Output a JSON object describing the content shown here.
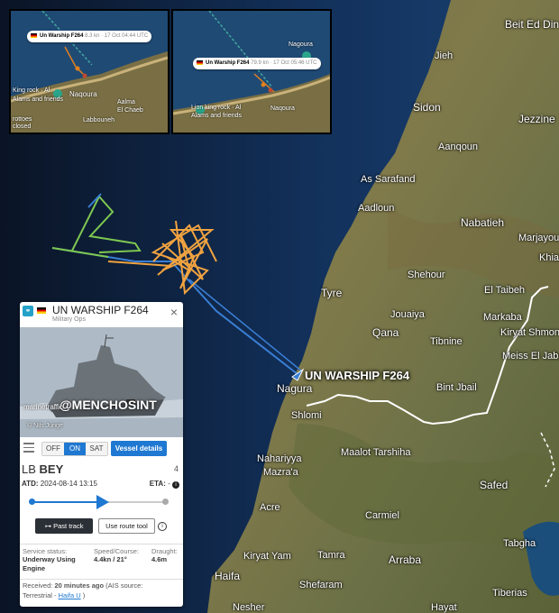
{
  "map": {
    "vessel_label": "UN WARSHIP F264",
    "places": [
      {
        "key": "beit",
        "name": "Beit Ed Dine"
      },
      {
        "key": "jieh",
        "name": "Jieh"
      },
      {
        "key": "sidon",
        "name": "Sidon"
      },
      {
        "key": "jezzine",
        "name": "Jezzine"
      },
      {
        "key": "aanqoun",
        "name": "Aanqoun"
      },
      {
        "key": "assarafand",
        "name": "As Sarafand"
      },
      {
        "key": "aadloun",
        "name": "Aadloun"
      },
      {
        "key": "nabatieh",
        "name": "Nabatieh"
      },
      {
        "key": "marjayoun",
        "name": "Marjayoun"
      },
      {
        "key": "khiam",
        "name": "Khiam"
      },
      {
        "key": "shehour",
        "name": "Shehour"
      },
      {
        "key": "tyre",
        "name": "Tyre"
      },
      {
        "key": "eltaibeh",
        "name": "El Taibeh"
      },
      {
        "key": "jouaiya",
        "name": "Jouaiya"
      },
      {
        "key": "markaba",
        "name": "Markaba"
      },
      {
        "key": "qana",
        "name": "Qana"
      },
      {
        "key": "kiryat",
        "name": "Kiryat Shmona"
      },
      {
        "key": "tibnine",
        "name": "Tibnine"
      },
      {
        "key": "meiss",
        "name": "Meiss El Jabal"
      },
      {
        "key": "bintjbail",
        "name": "Bint Jbail"
      },
      {
        "key": "nagura",
        "name": "Nagura"
      },
      {
        "key": "shlomi",
        "name": "Shlomi"
      },
      {
        "key": "maalot",
        "name": "Maalot Tarshiha"
      },
      {
        "key": "nahariyya",
        "name": "Nahariyya"
      },
      {
        "key": "mazraa",
        "name": "Mazra'a"
      },
      {
        "key": "safed",
        "name": "Safed"
      },
      {
        "key": "acre",
        "name": "Acre"
      },
      {
        "key": "carmiel",
        "name": "Carmiel"
      },
      {
        "key": "tabgha",
        "name": "Tabgha"
      },
      {
        "key": "kiryatyam",
        "name": "Kiryat Yam"
      },
      {
        "key": "tamra",
        "name": "Tamra"
      },
      {
        "key": "arraba",
        "name": "Arraba"
      },
      {
        "key": "haifa",
        "name": "Haifa"
      },
      {
        "key": "shfaram",
        "name": "Shefaram"
      },
      {
        "key": "tiberias",
        "name": "Tiberias"
      },
      {
        "key": "nesher",
        "name": "Nesher"
      },
      {
        "key": "hayat",
        "name": "Hayat"
      }
    ]
  },
  "insets": [
    {
      "pill_name": "Un Warship F264",
      "pill_meta": "8.3 kn · 17 Oct 04:44 UTC",
      "labels": [
        "King rock · Al",
        "Alams and friends",
        "Naqoura",
        "Aalma",
        "El Chaeb",
        "Labbouneh",
        "rottoes",
        "closed"
      ]
    },
    {
      "pill_name": "Un Warship F264",
      "pill_meta": "79.9 kn · 17 Oct 05:46 UTC",
      "labels": [
        "Nagoura",
        "Lion king rock · Al",
        "Alams and friends",
        "Naqoura"
      ]
    }
  ],
  "panel": {
    "vessel_name": "UN WARSHIP F264",
    "vessel_type": "Military Ops",
    "watermark": "@MENCHOSINT",
    "photo_credit": "marinetraffic",
    "photo_credit2": "© Nils Jungé",
    "toggle": [
      "OFF",
      "ON",
      "SAT"
    ],
    "toggle_active": "ON",
    "details_label": "Vessel details",
    "from_port_code": "LB",
    "from_port_name": "BEY",
    "to_count": "4",
    "atd_label": "ATD:",
    "atd_value": "2024-08-14 13:15",
    "eta_label": "ETA:",
    "eta_value": "-",
    "progress": 0.5,
    "past_track_label": "Past track",
    "route_tool_label": "Use route tool",
    "status_key": "Service status:",
    "status_value": "Underway Using Engine",
    "speed_key": "Speed/Course:",
    "speed_value": "4.4kn / 21°",
    "draught_key": "Draught:",
    "draught_value": "4.6m",
    "received_key": "Received:",
    "received_value": "20 minutes ago",
    "ais_key": "(AIS source:",
    "ais_type": "Terrestrial -",
    "ais_station": "Haifa U",
    "ais_close": ")"
  },
  "colors": {
    "track_blue": "#3a7fd5",
    "track_green": "#7ec850",
    "track_orange": "#f0a340",
    "border_white": "#ffffff",
    "accent": "#1f78d1"
  }
}
